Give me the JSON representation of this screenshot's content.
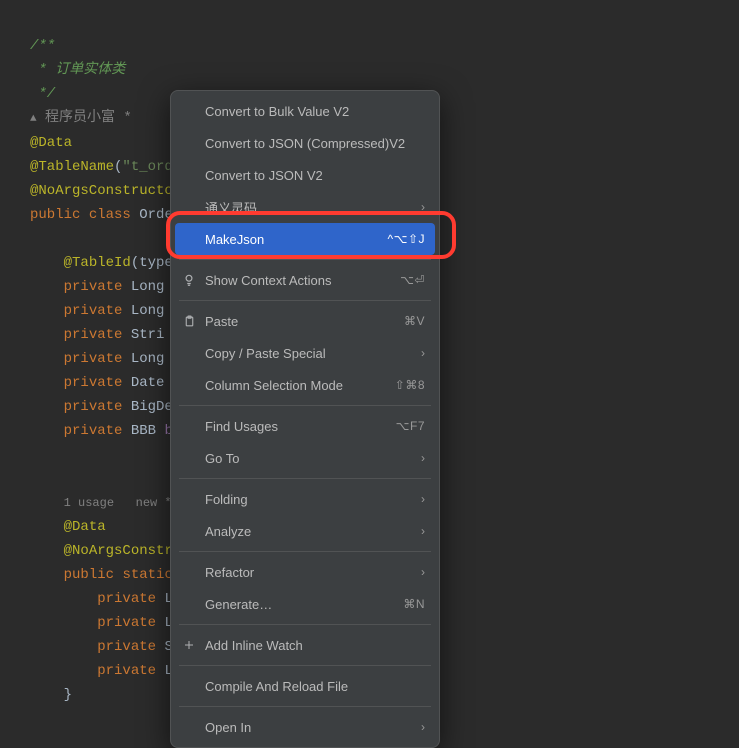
{
  "code": {
    "comment_open": "/**",
    "comment_line": " * 订单实体类",
    "comment_close": " */",
    "author_icon": "▲",
    "author": "程序员小富 *",
    "anno_data": "@Data",
    "anno_table_prefix": "@TableName",
    "paren_open": "(",
    "str_table": "\"t_ord",
    "anno_noargs": "@NoArgsConstructo",
    "kw_public": "public",
    "kw_class": "class",
    "cls_name": "Orde",
    "anno_tableid_prefix": "@TableId",
    "anno_tableid_arg": "(type",
    "kw_private": "private",
    "type_long": "Long",
    "type_string": "Stri",
    "type_date": "Date",
    "type_bigdec": "BigDe",
    "type_bbb": "BBB",
    "field_b": "b",
    "usage_text": "1 usage   new *",
    "inner_anno_data": "@Data",
    "inner_anno_noargs": "@NoArgsConstr",
    "kw_static": "static",
    "inner_type_l": "L",
    "inner_type_s": "S",
    "brace_close": "}"
  },
  "menu": {
    "convert_bulk": "Convert to Bulk Value V2",
    "convert_json_comp": "Convert to JSON (Compressed)V2",
    "convert_json": "Convert to JSON V2",
    "tongyi": "通义灵码",
    "makejson": "MakeJson",
    "makejson_sc": "^⌥⇧J",
    "show_context": "Show Context Actions",
    "show_context_sc": "⌥⏎",
    "paste": "Paste",
    "paste_sc": "⌘V",
    "copy_paste_special": "Copy / Paste Special",
    "column_sel": "Column Selection Mode",
    "column_sel_sc": "⇧⌘8",
    "find_usages": "Find Usages",
    "find_usages_sc": "⌥F7",
    "goto": "Go To",
    "folding": "Folding",
    "analyze": "Analyze",
    "refactor": "Refactor",
    "generate": "Generate…",
    "generate_sc": "⌘N",
    "add_inline": "Add Inline Watch",
    "compile_reload": "Compile And Reload File",
    "open_in": "Open In"
  }
}
